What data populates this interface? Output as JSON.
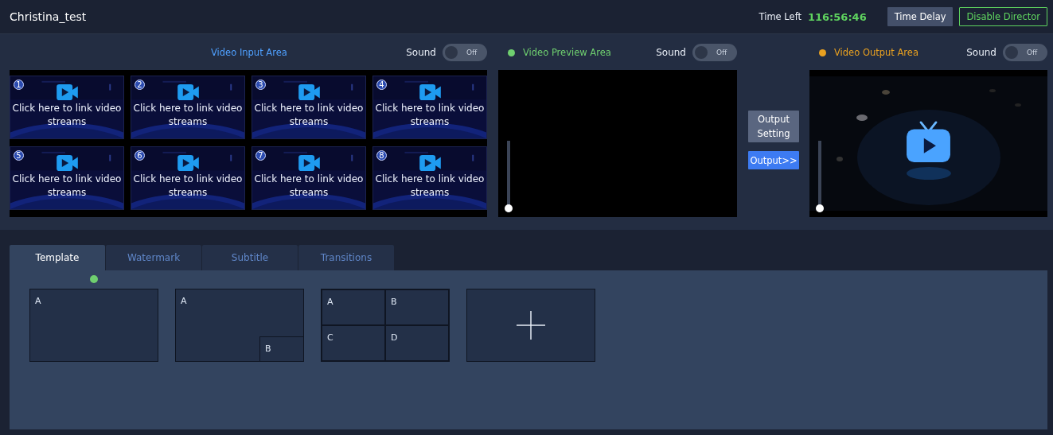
{
  "header": {
    "title": "Christina_test",
    "time_left_label": "Time Left",
    "time_left": "116:56:46",
    "buttons": [
      {
        "label": "Time Delay",
        "kind": "plain"
      },
      {
        "label": "Disable Director",
        "kind": "outline"
      }
    ]
  },
  "input_area": {
    "title": "Video Input Area",
    "sound": {
      "label": "Sound",
      "on": false,
      "state_text": "Off"
    },
    "tiles": [
      {
        "number": "1",
        "text": "Click here to link video streams"
      },
      {
        "number": "2",
        "text": "Click here to link video streams"
      },
      {
        "number": "3",
        "text": "Click here to link video streams"
      },
      {
        "number": "4",
        "text": "Click here to link video streams"
      },
      {
        "number": "5",
        "text": "Click here to link video streams"
      },
      {
        "number": "6",
        "text": "Click here to link video streams"
      },
      {
        "number": "7",
        "text": "Click here to link video streams"
      },
      {
        "number": "8",
        "text": "Click here to link video streams"
      }
    ]
  },
  "preview_area": {
    "title": "Video Preview Area",
    "color": "#6fcf6f",
    "sound": {
      "label": "Sound",
      "on": false,
      "state_text": "Off"
    },
    "volume": {
      "level": 0
    }
  },
  "output_controls": [
    {
      "label": "Output Setting",
      "kind": "setting"
    },
    {
      "label": "Output>>",
      "kind": "primary"
    }
  ],
  "output_area": {
    "title": "Video Output Area",
    "color": "#e8a020",
    "sound": {
      "label": "Sound",
      "on": false,
      "state_text": "Off"
    },
    "volume": {
      "level": 0
    }
  },
  "tabs": [
    {
      "label": "Template",
      "selected": true
    },
    {
      "label": "Watermark",
      "selected": false
    },
    {
      "label": "Subtitle",
      "selected": false
    },
    {
      "label": "Transitions",
      "selected": false
    }
  ],
  "templates": [
    {
      "kind": "single",
      "selected": true,
      "cells": [
        "A"
      ]
    },
    {
      "kind": "pip",
      "selected": false,
      "cells": [
        "A",
        "B"
      ]
    },
    {
      "kind": "quad",
      "selected": false,
      "cells": [
        "A",
        "B",
        "C",
        "D"
      ]
    },
    {
      "kind": "add",
      "selected": false
    }
  ]
}
